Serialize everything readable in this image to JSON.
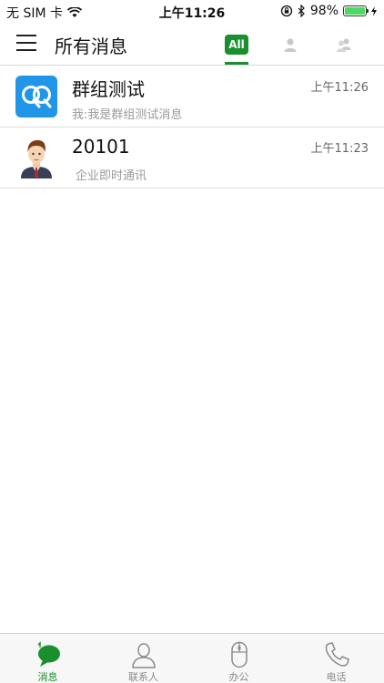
{
  "status_bar": {
    "carrier": "无 SIM 卡",
    "time": "上午11:26",
    "battery": "98%",
    "battery_level": 0.98
  },
  "header": {
    "title": "所有消息",
    "filter_all": "All"
  },
  "messages": [
    {
      "name": "群组测试",
      "preview": "我:我是群组测试消息",
      "time": "上午11:26",
      "avatar_icon": "group-chat-icon"
    },
    {
      "name": "20101",
      "preview": "企业即时通讯",
      "time": "上午11:23",
      "avatar_icon": "person-avatar"
    }
  ],
  "tabbar": {
    "tabs": [
      {
        "label": "消息",
        "icon": "chat-bubble-icon",
        "active": true
      },
      {
        "label": "联系人",
        "icon": "contact-person-icon",
        "active": false
      },
      {
        "label": "办公",
        "icon": "mouse-icon",
        "active": false
      },
      {
        "label": "电话",
        "icon": "phone-icon",
        "active": false
      }
    ]
  },
  "colors": {
    "accent": "#1a8f2e",
    "group_avatar": "#2196e8",
    "battery": "#4cd964"
  }
}
